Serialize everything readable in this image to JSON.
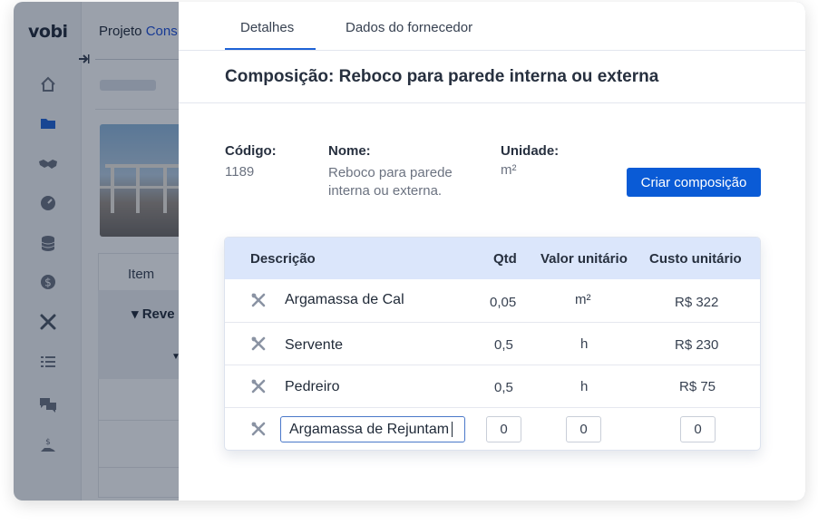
{
  "background": {
    "logo": "vobi",
    "project_title_prefix": "Projeto ",
    "project_title_accent": "Cons",
    "table_header_item": "Item",
    "row_group_label": "Reve",
    "nav_icons": [
      "home-icon",
      "folder-icon",
      "handshake-icon",
      "gauge-icon",
      "database-icon",
      "dollar-icon",
      "tools-icon",
      "list-icon",
      "chat-icon",
      "payment-icon"
    ]
  },
  "tabs": [
    {
      "label": "Detalhes",
      "active": true
    },
    {
      "label": "Dados do fornecedor",
      "active": false
    }
  ],
  "composition": {
    "title": "Composição: Reboco para parede interna ou externa",
    "code_label": "Código:",
    "code_value": "1189",
    "name_label": "Nome:",
    "name_value_line1": "Reboco para parede",
    "name_value_line2": "interna ou externa.",
    "unit_label": "Unidade:",
    "unit_value": "m²",
    "create_button": "Criar composição"
  },
  "table": {
    "headers": {
      "description": "Descrição",
      "qty": "Qtd",
      "unit_value": "Valor unitário",
      "unit_cost": "Custo unitário"
    },
    "rows": [
      {
        "description": "Argamassa de Cal",
        "qty": "0,05",
        "unit": "m²",
        "cost": "R$ 322"
      },
      {
        "description": "Servente",
        "qty": "0,5",
        "unit": "h",
        "cost": "R$ 230"
      },
      {
        "description": "Pedreiro",
        "qty": "0,5",
        "unit": "h",
        "cost": "R$ 75"
      }
    ],
    "new_row": {
      "description": "Argamassa de Rejuntam",
      "qty": "0",
      "unit_value": "0",
      "cost": "0"
    }
  },
  "colors": {
    "accent": "#0a5bd6",
    "table_header_bg": "#dbe6fb",
    "overlay": "#101e37"
  }
}
